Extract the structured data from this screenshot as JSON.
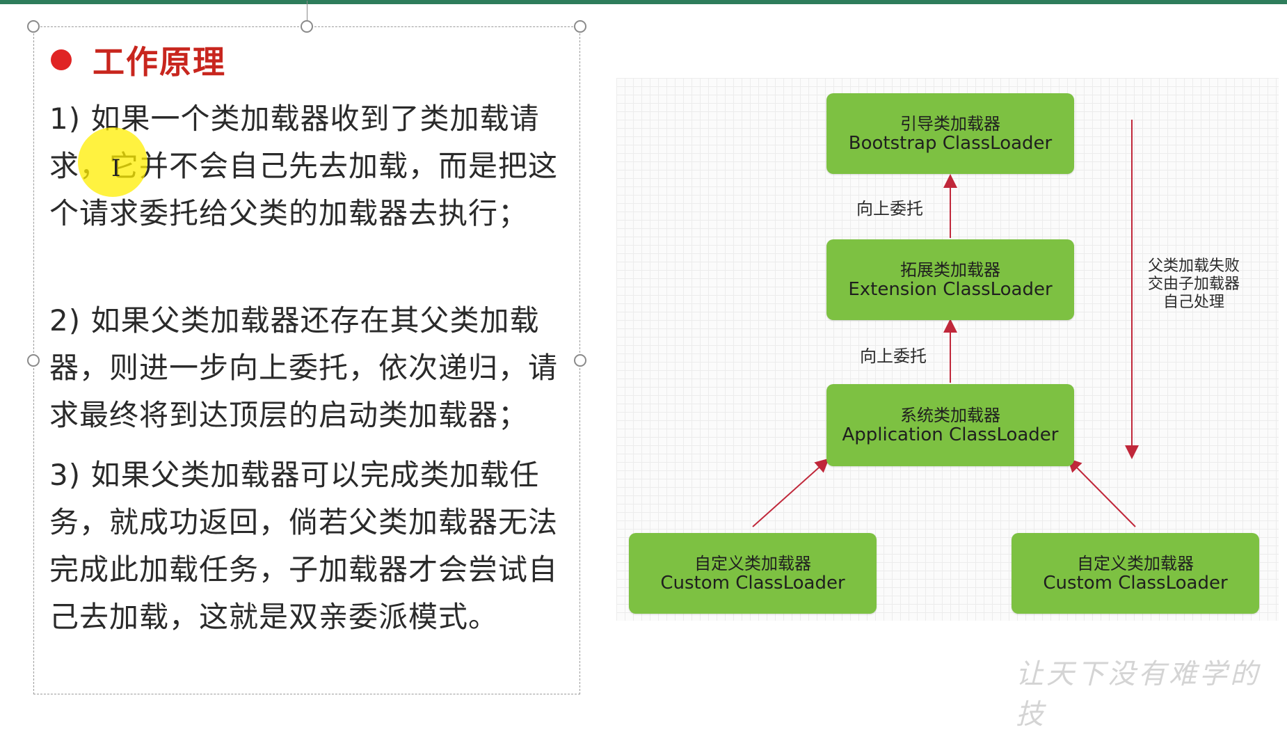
{
  "slide": {
    "heading": "工作原理",
    "paragraphs": [
      "1) 如果一个类加载器收到了类加载请求，它并不会自己先去加载，而是把这个请求委托给父类的加载器去执行；",
      "2) 如果父类加载器还存在其父类加载器，则进一步向上委托，依次递归，请求最终将到达顶层的启动类加载器；",
      "3) 如果父类加载器可以完成类加载任务，就成功返回，倘若父类加载器无法完成此加载任务，子加载器才会尝试自己去加载，这就是双亲委派模式。"
    ]
  },
  "diagram": {
    "nodes": {
      "bootstrap": {
        "zh": "引导类加载器",
        "en": "Bootstrap ClassLoader"
      },
      "extension": {
        "zh": "拓展类加载器",
        "en": "Extension ClassLoader"
      },
      "application": {
        "zh": "系统类加载器",
        "en": "Application ClassLoader"
      },
      "custom1": {
        "zh": "自定义类加载器",
        "en": "Custom ClassLoader"
      },
      "custom2": {
        "zh": "自定义类加载器",
        "en": "Custom ClassLoader"
      }
    },
    "edge_labels": {
      "up1": "向上委托",
      "up2": "向上委托"
    },
    "side_note_lines": [
      "父类加载失败",
      "交由子加载器",
      "自己处理"
    ],
    "colors": {
      "node_fill": "#7dc142",
      "arrow": "#c0273a",
      "heading": "#c8261e",
      "bullet": "#e02424"
    }
  },
  "watermark": "让天下没有难学的技"
}
